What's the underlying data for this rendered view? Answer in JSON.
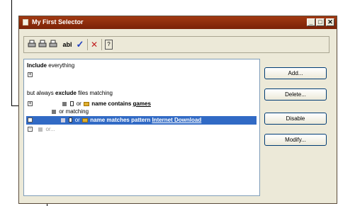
{
  "window": {
    "title": "My First Selector",
    "controls": {
      "minimize": "_",
      "maximize": "□",
      "close": "✕"
    }
  },
  "toolbar": {
    "icons": [
      "printer-icon",
      "printer-icon",
      "printer-icon",
      "text-field-icon",
      "check-icon",
      "delete-icon",
      "help-icon"
    ],
    "text_tool": "abl",
    "check": "✓",
    "delete": "✕",
    "help": "?"
  },
  "tree": {
    "include_bold": "Include",
    "include_rest": "everything",
    "exclude_pre": "but always",
    "exclude_bold": "exclude",
    "exclude_post": "files matching",
    "rule1_or": "or",
    "rule1_text": "name contains",
    "rule1_value": "games",
    "or_matching_or": "or",
    "or_matching_text": "matching",
    "rule2_or": "or",
    "rule2_text": "name matches pattern",
    "rule2_value": "Internet Download",
    "last_or": "or..."
  },
  "buttons": {
    "add": "Add...",
    "delete": "Delete...",
    "disable": "Disable",
    "modify": "Modify..."
  }
}
